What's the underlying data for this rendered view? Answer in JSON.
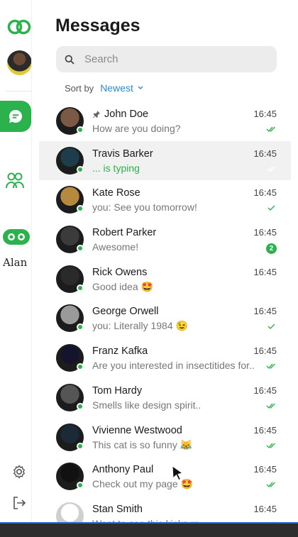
{
  "app": {
    "title": "Messages",
    "current_user": "Alan"
  },
  "colors": {
    "accent": "#2bb24c",
    "link": "#2b8ccc"
  },
  "search": {
    "placeholder": "Search"
  },
  "sort": {
    "label": "Sort by",
    "value": "Newest"
  },
  "conversations": [
    {
      "name": "John Doe",
      "preview": "How are you doing?",
      "time": "16:45",
      "status": "read",
      "pinned": true,
      "online": true,
      "avatar_color": "#7a5a44"
    },
    {
      "name": "Travis Barker",
      "preview": "... is typing",
      "time": "16:45",
      "status": "read",
      "typing": true,
      "active": true,
      "online": true,
      "avatar_color": "#1e3d4a"
    },
    {
      "name": "Kate Rose",
      "preview": "you: See you tomorrow!",
      "time": "16:45",
      "status": "sent",
      "online": true,
      "avatar_color": "#b58a3f"
    },
    {
      "name": "Robert Parker",
      "preview": "Awesome!",
      "time": "16:45",
      "status": "unread",
      "unread_count": "2",
      "online": true,
      "avatar_color": "#3b3b3b"
    },
    {
      "name": "Rick Owens",
      "preview": "Good idea 🤩",
      "time": "16:45",
      "status": "none",
      "online": true,
      "avatar_color": "#2a2a2a"
    },
    {
      "name": "George Orwell",
      "preview": "you: Literally 1984 😉",
      "time": "16:45",
      "status": "sent",
      "online": true,
      "avatar_color": "#9a9a9a"
    },
    {
      "name": "Franz Kafka",
      "preview": "Are you interested in insectitides for..",
      "time": "16:45",
      "status": "read",
      "online": true,
      "avatar_color": "#14142e"
    },
    {
      "name": "Tom Hardy",
      "preview": "Smells like design spirit..",
      "time": "16:45",
      "status": "read",
      "online": true,
      "avatar_color": "#555555"
    },
    {
      "name": "Vivienne Westwood",
      "preview": "This cat is so funny 😹",
      "time": "16:45",
      "status": "read",
      "online": true,
      "avatar_color": "#1b2a36"
    },
    {
      "name": "Anthony Paul",
      "preview": "Check out my page 🤩",
      "time": "16:45",
      "status": "read",
      "online": true,
      "avatar_color": "#111111"
    },
    {
      "name": "Stan Smith",
      "preview": "Want to see this kicks rn",
      "time": "16:45",
      "status": "read",
      "online": false,
      "avatar_color": "#d8d8d8"
    }
  ]
}
